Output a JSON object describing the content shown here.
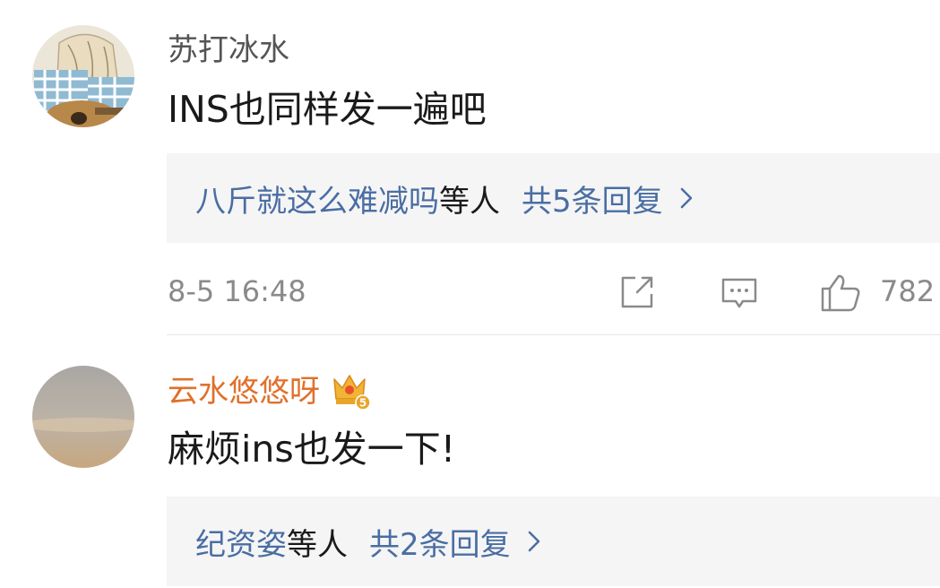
{
  "comments": [
    {
      "username": "苏打冰水",
      "username_color": "#555555",
      "text": "INS也同样发一遍吧",
      "reply_names": "八斤就这么难减吗",
      "reply_suffix": "等人",
      "reply_count": "共5条回复",
      "timestamp": "8-5 16:48",
      "likes": "782",
      "avatar_icon": "anime-girl-guitar-avatar"
    },
    {
      "username": "云水悠悠呀",
      "username_color": "#e0702b",
      "text": "麻烦ins也发一下!",
      "reply_names": "纪资姿",
      "reply_suffix": "等人",
      "reply_count": "共2条回复",
      "vip_badge_text": "5",
      "avatar_icon": "sunset-sky-avatar"
    }
  ],
  "colors": {
    "link_blue": "#4a6ea3",
    "meta_gray": "#8a8a8a",
    "reply_bg": "#f5f5f5"
  },
  "icons": [
    "share-icon",
    "comment-icon",
    "like-icon",
    "chevron-right-icon",
    "vip-crown-icon"
  ]
}
